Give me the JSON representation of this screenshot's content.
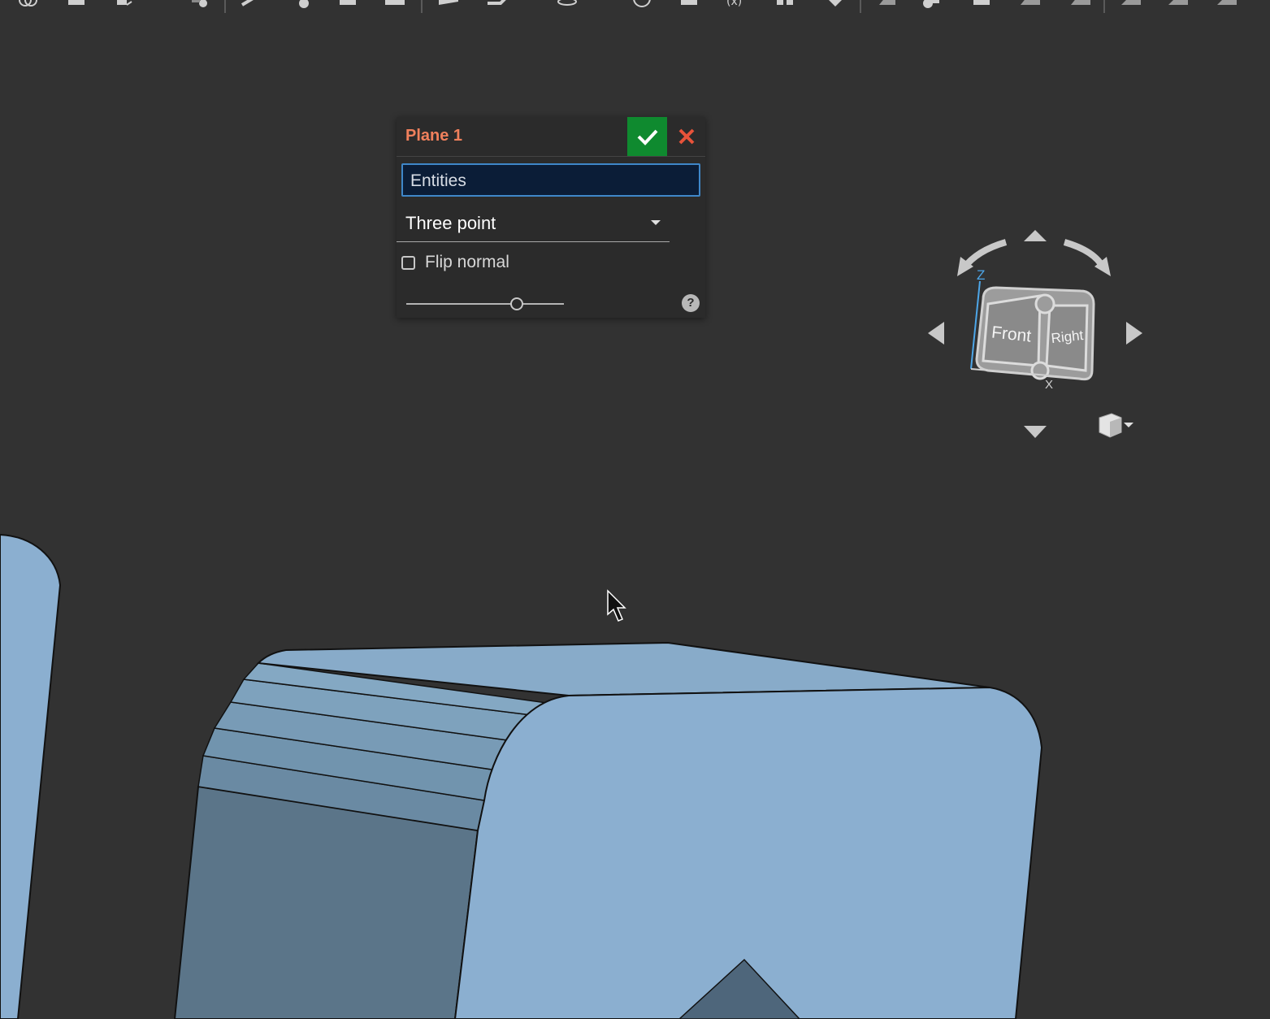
{
  "dialog": {
    "title": "Plane 1",
    "entities_placeholder": "Entities",
    "type_value": "Three point",
    "flip_normal_label": "Flip normal",
    "flip_normal_checked": false,
    "slider_fraction": 0.7,
    "help_label": "?"
  },
  "view_cube": {
    "front_label": "Front",
    "right_label": "Right",
    "z_label": "Z",
    "x_label": "X"
  },
  "colors": {
    "accent_title": "#f0805c",
    "accept_green": "#0f8a2f",
    "cancel_red": "#e8533a",
    "part_top": "#8bafd0",
    "part_side": "#5b7589",
    "background": "#323232"
  }
}
